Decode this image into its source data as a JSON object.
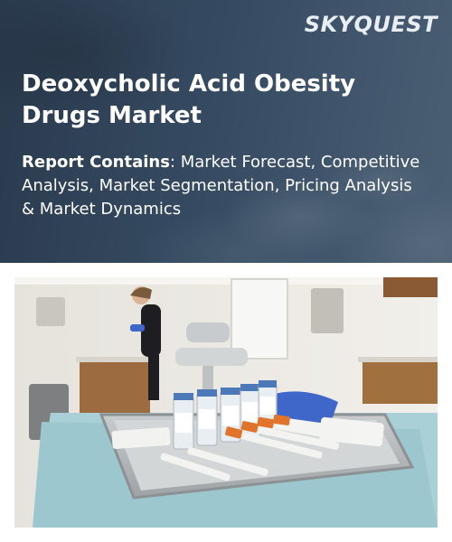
{
  "brand": {
    "logo_text": "SKYQUEST"
  },
  "report": {
    "title": "Deoxycholic Acid Obesity Drugs Market",
    "contains_label": "Report Contains",
    "contains_sep": ": ",
    "contains_text": "Market Forecast, Competitive Analysis, Market Segmentation, Pricing Analysis & Market Dynamics"
  },
  "colors": {
    "banner": "#354a61",
    "text": "#ffffff",
    "tray_cloth": "#9dc7cf",
    "glove": "#3f67c9",
    "syringe_cap": "#e0742b"
  },
  "image": {
    "subject": "clinic-tray-with-vials-and-syringes"
  }
}
